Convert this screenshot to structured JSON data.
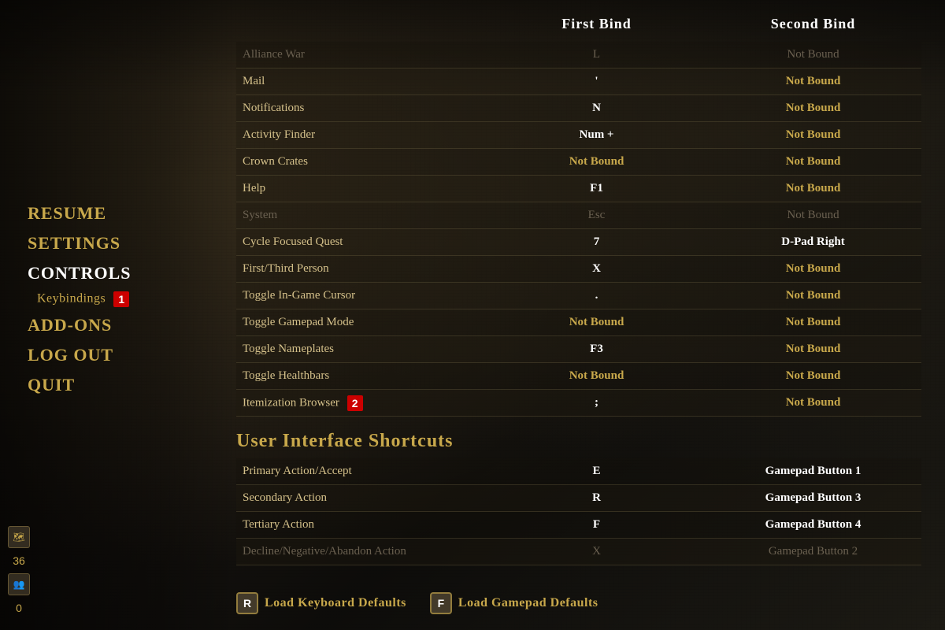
{
  "background": {
    "description": "Dark fantasy stone dungeon background"
  },
  "sidebar": {
    "items": [
      {
        "id": "resume",
        "label": "RESUME",
        "state": "normal"
      },
      {
        "id": "settings",
        "label": "SETTINGS",
        "state": "normal"
      },
      {
        "id": "controls",
        "label": "CONTROLS",
        "state": "active"
      },
      {
        "id": "keybindings",
        "label": "Keybindings",
        "state": "sub",
        "badge": "1"
      },
      {
        "id": "addons",
        "label": "ADD-ONS",
        "state": "normal"
      },
      {
        "id": "logout",
        "label": "LOG OUT",
        "state": "normal"
      },
      {
        "id": "quit",
        "label": "QUIT",
        "state": "normal"
      }
    ]
  },
  "table": {
    "columns": {
      "first_bind": "First Bind",
      "second_bind": "Second Bind"
    },
    "rows": [
      {
        "action": "Alliance War",
        "first": "L",
        "second": "Not Bound",
        "firstStyle": "active",
        "secondStyle": "dim-val",
        "dimmed": true
      },
      {
        "action": "Mail",
        "first": "'",
        "second": "Not Bound",
        "firstStyle": "active",
        "secondStyle": "not-bound"
      },
      {
        "action": "Notifications",
        "first": "N",
        "second": "Not Bound",
        "firstStyle": "active",
        "secondStyle": "not-bound"
      },
      {
        "action": "Activity Finder",
        "first": "Num +",
        "second": "Not Bound",
        "firstStyle": "active",
        "secondStyle": "not-bound"
      },
      {
        "action": "Crown Crates",
        "first": "Not Bound",
        "second": "Not Bound",
        "firstStyle": "not-bound",
        "secondStyle": "not-bound"
      },
      {
        "action": "Help",
        "first": "F1",
        "second": "Not Bound",
        "firstStyle": "active",
        "secondStyle": "not-bound"
      },
      {
        "action": "System",
        "first": "Esc",
        "second": "Not Bound",
        "firstStyle": "dim-val",
        "secondStyle": "dim-val",
        "dimmed": true
      },
      {
        "action": "Cycle Focused Quest",
        "first": "7",
        "second": "D-Pad Right",
        "firstStyle": "active",
        "secondStyle": "gamepad"
      },
      {
        "action": "First/Third Person",
        "first": "X",
        "second": "Not Bound",
        "firstStyle": "active",
        "secondStyle": "not-bound"
      },
      {
        "action": "Toggle In-Game Cursor",
        "first": ".",
        "second": "Not Bound",
        "firstStyle": "active",
        "secondStyle": "not-bound"
      },
      {
        "action": "Toggle Gamepad Mode",
        "first": "Not Bound",
        "second": "Not Bound",
        "firstStyle": "not-bound",
        "secondStyle": "not-bound"
      },
      {
        "action": "Toggle Nameplates",
        "first": "F3",
        "second": "Not Bound",
        "firstStyle": "active",
        "secondStyle": "not-bound"
      },
      {
        "action": "Toggle Healthbars",
        "first": "Not Bound",
        "second": "Not Bound",
        "firstStyle": "not-bound",
        "secondStyle": "not-bound"
      },
      {
        "action": "Itemization Browser",
        "first": ";",
        "second": "Not Bound",
        "firstStyle": "active",
        "secondStyle": "not-bound",
        "badge": "2"
      }
    ]
  },
  "section_ui": {
    "title": "User Interface Shortcuts",
    "rows": [
      {
        "action": "Primary Action/Accept",
        "first": "E",
        "second": "Gamepad Button 1",
        "firstStyle": "active",
        "secondStyle": "gamepad"
      },
      {
        "action": "Secondary Action",
        "first": "R",
        "second": "Gamepad Button 3",
        "firstStyle": "active",
        "secondStyle": "gamepad"
      },
      {
        "action": "Tertiary Action",
        "first": "F",
        "second": "Gamepad Button 4",
        "firstStyle": "active",
        "secondStyle": "gamepad"
      },
      {
        "action": "Decline/Negative/Abandon Action",
        "first": "X",
        "second": "Gamepad Button 2",
        "firstStyle": "dim-val",
        "secondStyle": "dim-val",
        "dimmed": true
      }
    ]
  },
  "bottom_bar": {
    "actions": [
      {
        "key": "R",
        "label": "Load Keyboard Defaults"
      },
      {
        "key": "F",
        "label": "Load Gamepad Defaults"
      }
    ]
  },
  "bottom_icons": [
    {
      "id": "map-icon",
      "symbol": "🗺"
    },
    {
      "id": "count-36",
      "value": "36"
    },
    {
      "id": "group-icon",
      "symbol": "👥"
    },
    {
      "id": "count-0",
      "value": "0"
    }
  ]
}
